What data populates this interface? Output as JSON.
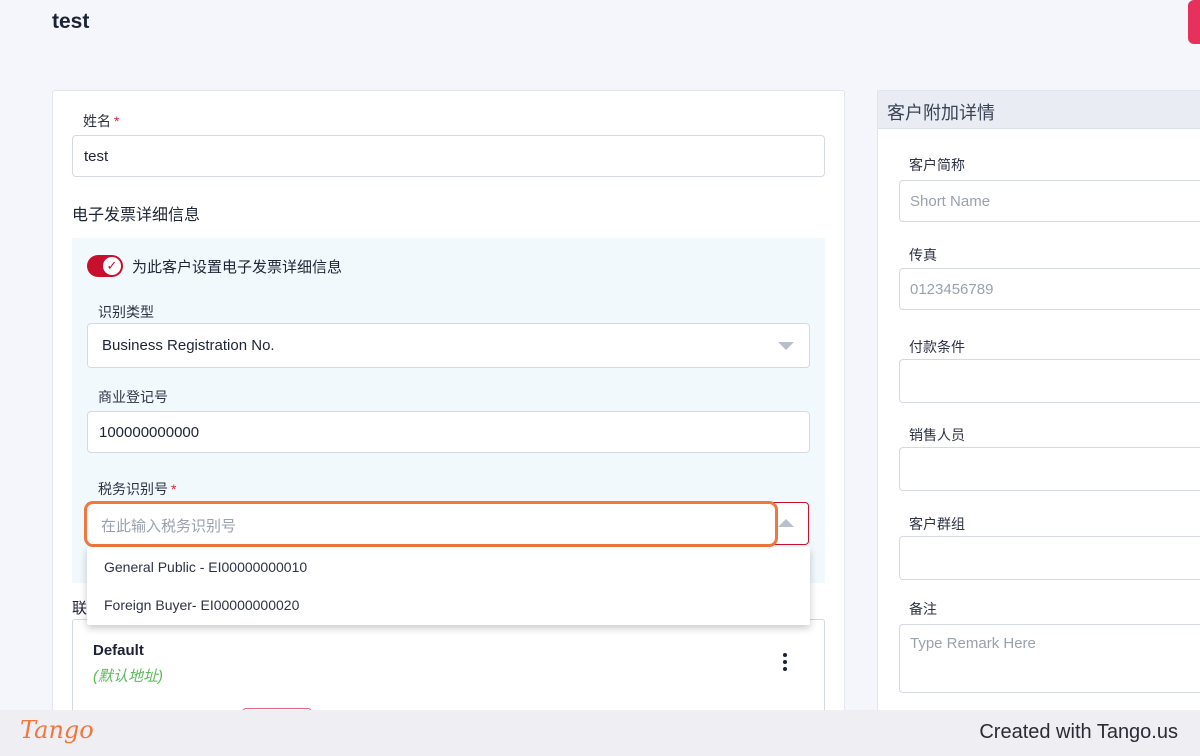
{
  "header": {
    "title": "test"
  },
  "customer_form": {
    "name_label": "姓名",
    "required_mark": "*",
    "name_value": "test",
    "einvoice_section_title": "电子发票详细信息",
    "einvoice_toggle_label": "为此客户设置电子发票详细信息",
    "einvoice_toggle_on": true,
    "id_type_label": "识别类型",
    "id_type_value": "Business Registration No.",
    "brn_label": "商业登记号",
    "brn_value": "100000000000",
    "tin_label": "税务识别号",
    "tin_placeholder": "在此输入税务识别号",
    "tin_options": [
      "General Public - EI00000000010",
      "Foreign Buyer- EI00000000020"
    ],
    "contact_section_partial": "联",
    "address": {
      "default_title": "Default",
      "default_subtitle": "(默认地址)"
    }
  },
  "side_panel": {
    "title": "客户附加详情",
    "short_name_label": "客户简称",
    "short_name_placeholder": "Short Name",
    "fax_label": "传真",
    "fax_placeholder": "0123456789",
    "payment_terms_label": "付款条件",
    "salesperson_label": "销售人员",
    "customer_group_label": "客户群组",
    "remark_label": "备注",
    "remark_placeholder": "Type Remark Here"
  },
  "footer": {
    "logo_text": "Tango",
    "credit_text": "Created with Tango.us"
  },
  "colors": {
    "accent_red": "#c8102e",
    "highlight_orange": "#f0773d",
    "panel_bg": "#f1f9fd",
    "default_address_green": "#5cb85c"
  },
  "icons": [
    "check-icon",
    "chevron-down-icon",
    "chevron-up-icon",
    "kebab-menu-icon"
  ]
}
